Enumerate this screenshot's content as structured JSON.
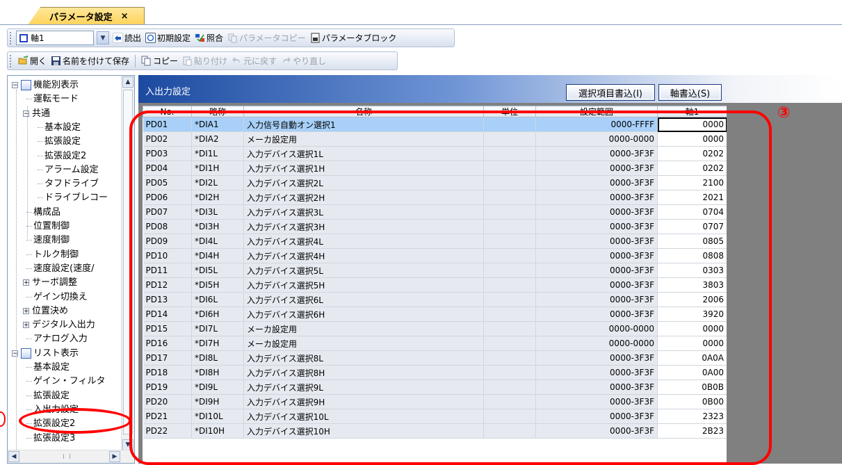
{
  "tab": {
    "title": "パラメータ設定",
    "close": "×"
  },
  "toolbar1": {
    "axis_value": "軸1",
    "read": "読出",
    "initial_setting": "初期設定",
    "verify": "照合",
    "param_copy": "パラメータコピー",
    "param_block": "パラメータブロック"
  },
  "toolbar2": {
    "open": "開く",
    "save_as": "名前を付けて保存",
    "copy": "コピー",
    "paste": "貼り付け",
    "undo": "元に戻す",
    "redo": "やり直し"
  },
  "tree": [
    {
      "label": "機能別表示",
      "level": 0,
      "expander": "−",
      "icon": "function-view-icon"
    },
    {
      "label": "運転モード",
      "level": 1
    },
    {
      "label": "共通",
      "level": 1,
      "expander": "−"
    },
    {
      "label": "基本設定",
      "level": 2
    },
    {
      "label": "拡張設定",
      "level": 2
    },
    {
      "label": "拡張設定2",
      "level": 2
    },
    {
      "label": "アラーム設定",
      "level": 2
    },
    {
      "label": "タフドライブ",
      "level": 2
    },
    {
      "label": "ドライブレコー",
      "level": 2
    },
    {
      "label": "構成品",
      "level": 1
    },
    {
      "label": "位置制御",
      "level": 1
    },
    {
      "label": "速度制御",
      "level": 1
    },
    {
      "label": "トルク制御",
      "level": 1
    },
    {
      "label": "速度設定(速度/",
      "level": 1
    },
    {
      "label": "サーボ調整",
      "level": 1,
      "expander": "+"
    },
    {
      "label": "ゲイン切換え",
      "level": 1
    },
    {
      "label": "位置決め",
      "level": 1,
      "expander": "+"
    },
    {
      "label": "デジタル入出力",
      "level": 1,
      "expander": "+"
    },
    {
      "label": "アナログ入力",
      "level": 1
    },
    {
      "label": "リスト表示",
      "level": 0,
      "expander": "−",
      "icon": "list-view-icon"
    },
    {
      "label": "基本設定",
      "level": 1
    },
    {
      "label": "ゲイン・フィルタ",
      "level": 1
    },
    {
      "label": "拡張設定",
      "level": 1
    },
    {
      "label": "入出力設定",
      "level": 1,
      "selected": true
    },
    {
      "label": "拡張設定2",
      "level": 1
    },
    {
      "label": "拡張設定3",
      "level": 1
    }
  ],
  "panel": {
    "title": "入出力設定",
    "write_selected": "選択項目書込(I)",
    "write_axis": "軸書込(S)"
  },
  "grid": {
    "columns": [
      "No.",
      "略称",
      "名称",
      "単位",
      "設定範囲",
      "軸1"
    ],
    "rows": [
      [
        "PD01",
        "*DIA1",
        "入力信号自動オン選択1",
        "",
        "0000-FFFF",
        "0000"
      ],
      [
        "PD02",
        "*DIA2",
        "メーカ設定用",
        "",
        "0000-0000",
        "0000"
      ],
      [
        "PD03",
        "*DI1L",
        "入力デバイス選択1L",
        "",
        "0000-3F3F",
        "0202"
      ],
      [
        "PD04",
        "*DI1H",
        "入力デバイス選択1H",
        "",
        "0000-3F3F",
        "0202"
      ],
      [
        "PD05",
        "*DI2L",
        "入力デバイス選択2L",
        "",
        "0000-3F3F",
        "2100"
      ],
      [
        "PD06",
        "*DI2H",
        "入力デバイス選択2H",
        "",
        "0000-3F3F",
        "2021"
      ],
      [
        "PD07",
        "*DI3L",
        "入力デバイス選択3L",
        "",
        "0000-3F3F",
        "0704"
      ],
      [
        "PD08",
        "*DI3H",
        "入力デバイス選択3H",
        "",
        "0000-3F3F",
        "0707"
      ],
      [
        "PD09",
        "*DI4L",
        "入力デバイス選択4L",
        "",
        "0000-3F3F",
        "0805"
      ],
      [
        "PD10",
        "*DI4H",
        "入力デバイス選択4H",
        "",
        "0000-3F3F",
        "0808"
      ],
      [
        "PD11",
        "*DI5L",
        "入力デバイス選択5L",
        "",
        "0000-3F3F",
        "0303"
      ],
      [
        "PD12",
        "*DI5H",
        "入力デバイス選択5H",
        "",
        "0000-3F3F",
        "3803"
      ],
      [
        "PD13",
        "*DI6L",
        "入力デバイス選択6L",
        "",
        "0000-3F3F",
        "2006"
      ],
      [
        "PD14",
        "*DI6H",
        "入力デバイス選択6H",
        "",
        "0000-3F3F",
        "3920"
      ],
      [
        "PD15",
        "*DI7L",
        "メーカ設定用",
        "",
        "0000-0000",
        "0000"
      ],
      [
        "PD16",
        "*DI7H",
        "メーカ設定用",
        "",
        "0000-0000",
        "0000"
      ],
      [
        "PD17",
        "*DI8L",
        "入力デバイス選択8L",
        "",
        "0000-3F3F",
        "0A0A"
      ],
      [
        "PD18",
        "*DI8H",
        "入力デバイス選択8H",
        "",
        "0000-3F3F",
        "0A00"
      ],
      [
        "PD19",
        "*DI9L",
        "入力デバイス選択9L",
        "",
        "0000-3F3F",
        "0B0B"
      ],
      [
        "PD20",
        "*DI9H",
        "入力デバイス選択9H",
        "",
        "0000-3F3F",
        "0B00"
      ],
      [
        "PD21",
        "*DI10L",
        "入力デバイス選択10L",
        "",
        "0000-3F3F",
        "2323"
      ],
      [
        "PD22",
        "*DI10H",
        "入力デバイス選択10H",
        "",
        "0000-3F3F",
        "2B23"
      ]
    ],
    "selected_row": 0
  },
  "annotation": {
    "marker": "③"
  },
  "colors": {
    "annotation": "#ff0000",
    "selection": "#a8d0f8",
    "header_start": "#1b4aa0"
  }
}
